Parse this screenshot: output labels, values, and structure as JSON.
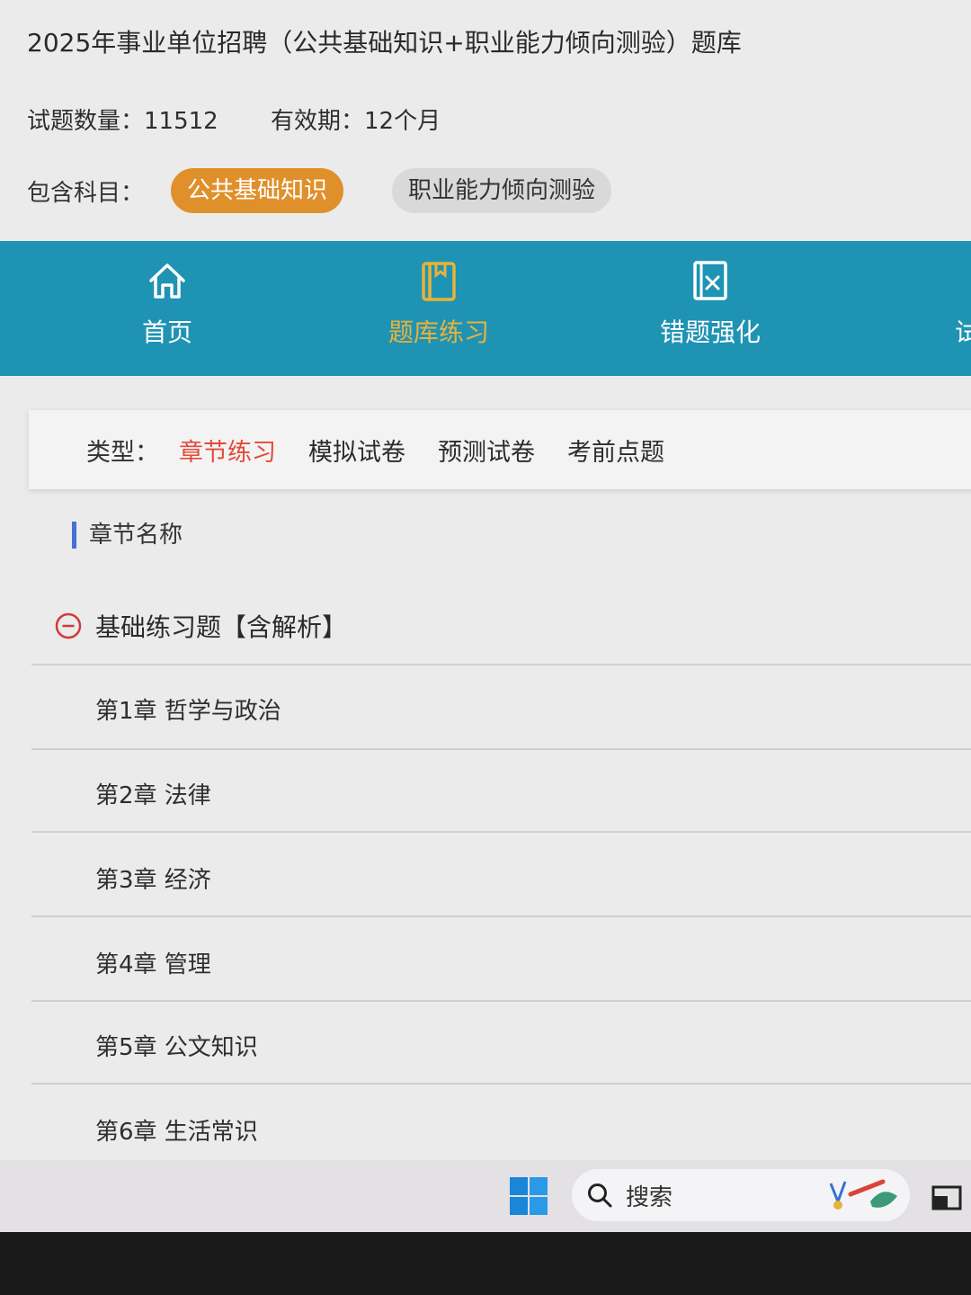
{
  "header": {
    "title": "2025年事业单位招聘（公共基础知识+职业能力倾向测验）题库",
    "question_count_label": "试题数量：11512",
    "validity_label": "有效期：12个月",
    "subjects_label": "包含科目：",
    "subjects": [
      {
        "label": "公共基础知识",
        "active": true
      },
      {
        "label": "职业能力倾向测验",
        "active": false
      }
    ]
  },
  "nav": {
    "items": [
      {
        "label": "首页",
        "icon": "home-icon",
        "active": false
      },
      {
        "label": "题库练习",
        "icon": "book-icon",
        "active": true
      },
      {
        "label": "错题强化",
        "icon": "wrong-answers-icon",
        "active": false
      },
      {
        "label": "试题",
        "icon": "more-icon",
        "active": false
      }
    ]
  },
  "type_filter": {
    "label": "类型：",
    "options": [
      {
        "label": "章节练习",
        "active": true
      },
      {
        "label": "模拟试卷",
        "active": false
      },
      {
        "label": "预测试卷",
        "active": false
      },
      {
        "label": "考前点题",
        "active": false
      }
    ]
  },
  "chapters": {
    "heading": "章节名称",
    "group_title": "基础练习题【含解析】",
    "items": [
      "第1章 哲学与政治",
      "第2章 法律",
      "第3章 经济",
      "第4章 管理",
      "第5章 公文知识",
      "第6章 生活常识"
    ]
  },
  "taskbar": {
    "search_placeholder": "搜索"
  },
  "colors": {
    "nav_bg": "#1f93b3",
    "nav_active": "#e8b23a",
    "chip_active": "#e0902a",
    "type_active": "#e34b3a",
    "heading_bar": "#4a6fd6"
  }
}
